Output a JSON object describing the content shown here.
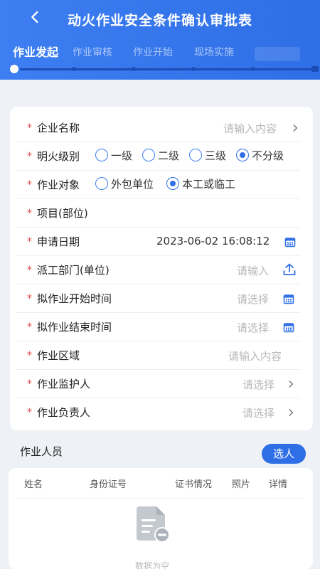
{
  "header": {
    "title": "动火作业安全条件确认审批表",
    "steps": [
      "作业发起",
      "作业审核",
      "作业开始",
      "现场实施"
    ]
  },
  "form": {
    "company": {
      "label": "企业名称",
      "placeholder": "请输入内容"
    },
    "fire_level": {
      "label": "明火级别",
      "options": [
        "一级",
        "二级",
        "三级",
        "不分级"
      ],
      "selected": "不分级"
    },
    "target": {
      "label": "作业对象",
      "options": [
        "外包单位",
        "本工或临工"
      ],
      "selected": "本工或临工"
    },
    "project": {
      "label": "项目(部位)"
    },
    "apply_date": {
      "label": "申请日期",
      "value": "2023-06-02 16:08:12"
    },
    "department": {
      "label": "派工部门(单位)",
      "placeholder": "请输入"
    },
    "start_time": {
      "label": "拟作业开始时间",
      "placeholder": "请选择"
    },
    "end_time": {
      "label": "拟作业结束时间",
      "placeholder": "请选择"
    },
    "area": {
      "label": "作业区域",
      "placeholder": "请输入内容"
    },
    "guardian": {
      "label": "作业监护人",
      "placeholder": "请选择"
    },
    "leader": {
      "label": "作业负责人",
      "placeholder": "请选择"
    }
  },
  "personnel": {
    "title": "作业人员",
    "select_button": "选人",
    "columns": [
      "姓名",
      "身份证号",
      "证书情况",
      "照片",
      "详情"
    ],
    "empty_text": "数据为空"
  },
  "colors": {
    "primary": "#2f6fe6",
    "required": "#e34d4d"
  }
}
